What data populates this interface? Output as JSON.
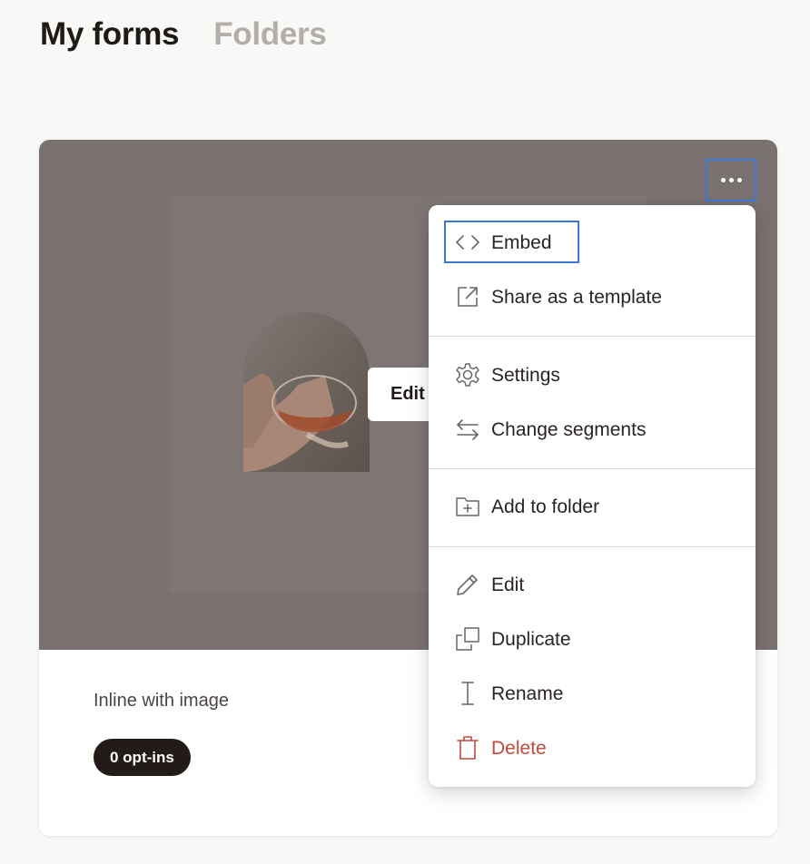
{
  "tabs": [
    {
      "label": "My forms",
      "active": true
    },
    {
      "label": "Folders",
      "active": false
    }
  ],
  "form": {
    "name": "Inline with image",
    "optins_badge": "0 opt-ins",
    "preview_edit_label": "Edit"
  },
  "menu": {
    "embed": "Embed",
    "share_template": "Share as a template",
    "settings": "Settings",
    "change_segments": "Change segments",
    "add_to_folder": "Add to folder",
    "edit": "Edit",
    "duplicate": "Duplicate",
    "rename": "Rename",
    "delete": "Delete"
  },
  "icons": {
    "more": "more-horizontal-icon",
    "embed": "code-icon",
    "share": "external-link-icon",
    "settings": "gear-icon",
    "segments": "swap-arrows-icon",
    "folder": "folder-plus-icon",
    "edit": "pencil-icon",
    "duplicate": "duplicate-icon",
    "rename": "text-cursor-icon",
    "delete": "trash-icon"
  },
  "colors": {
    "focus_ring": "#3b78d6",
    "danger": "#c4493e",
    "badge_bg": "#231b18",
    "preview_bg": "#7a7270"
  }
}
